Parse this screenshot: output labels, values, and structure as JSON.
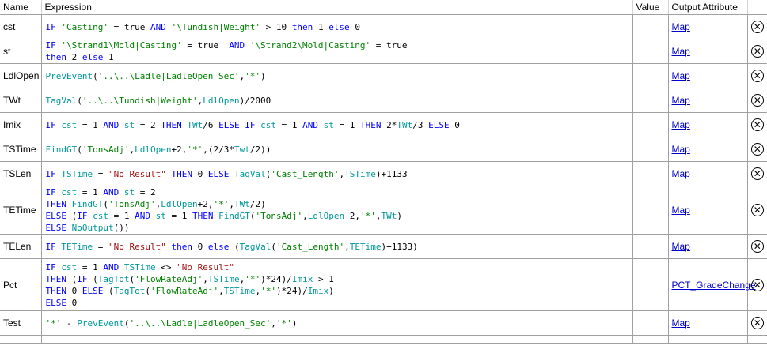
{
  "columns": {
    "name": "Name",
    "expression": "Expression",
    "value": "Value",
    "output": "Output Attribute"
  },
  "rows": [
    {
      "name": "cst",
      "link": "Map",
      "lines": [
        [
          [
            "kw",
            "IF "
          ],
          [
            "st",
            "'Casting'"
          ],
          [
            "tx",
            " = true "
          ],
          [
            "kw",
            "AND "
          ],
          [
            "st",
            "'\\Tundish|Weight'"
          ],
          [
            "tx",
            " > 10 "
          ],
          [
            "kw",
            "then "
          ],
          [
            "tx",
            "1 "
          ],
          [
            "kw",
            "else "
          ],
          [
            "tx",
            "0"
          ]
        ]
      ]
    },
    {
      "name": "st",
      "link": "Map",
      "lines": [
        [
          [
            "kw",
            "IF "
          ],
          [
            "st",
            "'\\Strand1\\Mold|Casting'"
          ],
          [
            "tx",
            " = true  "
          ],
          [
            "kw",
            "AND "
          ],
          [
            "st",
            "'\\Strand2\\Mold|Casting'"
          ],
          [
            "tx",
            " = true"
          ]
        ],
        [
          [
            "kw",
            "then "
          ],
          [
            "tx",
            "2 "
          ],
          [
            "kw",
            "else "
          ],
          [
            "tx",
            "1"
          ]
        ]
      ]
    },
    {
      "name": "LdlOpen",
      "link": "Map",
      "lines": [
        [
          [
            "fn",
            "PrevEvent"
          ],
          [
            "tx",
            "("
          ],
          [
            "st",
            "'..\\..\\Ladle|LadleOpen_Sec'"
          ],
          [
            "tx",
            ","
          ],
          [
            "st",
            "'*'"
          ],
          [
            "tx",
            ")"
          ]
        ]
      ]
    },
    {
      "name": "TWt",
      "link": "Map",
      "lines": [
        [
          [
            "fn",
            "TagVal"
          ],
          [
            "tx",
            "("
          ],
          [
            "st",
            "'..\\..\\Tundish|Weight'"
          ],
          [
            "tx",
            ","
          ],
          [
            "fn",
            "LdlOpen"
          ],
          [
            "tx",
            ")/2000"
          ]
        ]
      ]
    },
    {
      "name": "Imix",
      "link": "Map",
      "lines": [
        [
          [
            "kw",
            "IF "
          ],
          [
            "fn",
            "cst"
          ],
          [
            "tx",
            " = 1 "
          ],
          [
            "kw",
            "AND "
          ],
          [
            "fn",
            "st"
          ],
          [
            "tx",
            " = 2 "
          ],
          [
            "kw",
            "THEN "
          ],
          [
            "fn",
            "TWt"
          ],
          [
            "tx",
            "/6 "
          ],
          [
            "kw",
            "ELSE IF "
          ],
          [
            "fn",
            "cst"
          ],
          [
            "tx",
            " = 1 "
          ],
          [
            "kw",
            "AND "
          ],
          [
            "fn",
            "st"
          ],
          [
            "tx",
            " = 1 "
          ],
          [
            "kw",
            "THEN "
          ],
          [
            "tx",
            "2*"
          ],
          [
            "fn",
            "TWt"
          ],
          [
            "tx",
            "/3 "
          ],
          [
            "kw",
            "ELSE "
          ],
          [
            "tx",
            "0"
          ]
        ]
      ]
    },
    {
      "name": "TSTime",
      "link": "Map",
      "lines": [
        [
          [
            "fn",
            "FindGT"
          ],
          [
            "tx",
            "("
          ],
          [
            "st",
            "'TonsAdj'"
          ],
          [
            "tx",
            ","
          ],
          [
            "fn",
            "LdlOpen"
          ],
          [
            "tx",
            "+2,"
          ],
          [
            "st",
            "'*'"
          ],
          [
            "tx",
            ",(2/3*"
          ],
          [
            "fn",
            "Twt"
          ],
          [
            "tx",
            "/2))"
          ]
        ]
      ]
    },
    {
      "name": "TSLen",
      "link": "Map",
      "lines": [
        [
          [
            "kw",
            "IF "
          ],
          [
            "fn",
            "TSTime"
          ],
          [
            "tx",
            " = "
          ],
          [
            "str",
            "\"No Result\""
          ],
          [
            "kw",
            " THEN "
          ],
          [
            "tx",
            "0 "
          ],
          [
            "kw",
            "ELSE "
          ],
          [
            "fn",
            "TagVal"
          ],
          [
            "tx",
            "("
          ],
          [
            "st",
            "'Cast_Length'"
          ],
          [
            "tx",
            ","
          ],
          [
            "fn",
            "TSTime"
          ],
          [
            "tx",
            ")+1133"
          ]
        ]
      ]
    },
    {
      "name": "TETime",
      "link": "Map",
      "lines": [
        [
          [
            "kw",
            "IF "
          ],
          [
            "fn",
            "cst"
          ],
          [
            "tx",
            " = 1 "
          ],
          [
            "kw",
            "AND "
          ],
          [
            "fn",
            "st"
          ],
          [
            "tx",
            " = 2"
          ]
        ],
        [
          [
            "kw",
            "THEN "
          ],
          [
            "fn",
            "FindGT"
          ],
          [
            "tx",
            "("
          ],
          [
            "st",
            "'TonsAdj'"
          ],
          [
            "tx",
            ","
          ],
          [
            "fn",
            "LdlOpen"
          ],
          [
            "tx",
            "+2,"
          ],
          [
            "st",
            "'*'"
          ],
          [
            "tx",
            ","
          ],
          [
            "fn",
            "TWt"
          ],
          [
            "tx",
            "/2)"
          ]
        ],
        [
          [
            "kw",
            "ELSE "
          ],
          [
            "tx",
            "("
          ],
          [
            "kw",
            "IF "
          ],
          [
            "fn",
            "cst"
          ],
          [
            "tx",
            " = 1 "
          ],
          [
            "kw",
            "AND "
          ],
          [
            "fn",
            "st"
          ],
          [
            "tx",
            " = 1 "
          ],
          [
            "kw",
            "THEN "
          ],
          [
            "fn",
            "FindGT"
          ],
          [
            "tx",
            "("
          ],
          [
            "st",
            "'TonsAdj'"
          ],
          [
            "tx",
            ","
          ],
          [
            "fn",
            "LdlOpen"
          ],
          [
            "tx",
            "+2,"
          ],
          [
            "st",
            "'*'"
          ],
          [
            "tx",
            ","
          ],
          [
            "fn",
            "TWt"
          ],
          [
            "tx",
            ")"
          ]
        ],
        [
          [
            "kw",
            "ELSE "
          ],
          [
            "fn",
            "NoOutput"
          ],
          [
            "tx",
            "())"
          ]
        ]
      ]
    },
    {
      "name": "TELen",
      "link": "Map",
      "lines": [
        [
          [
            "kw",
            "IF "
          ],
          [
            "fn",
            "TETime"
          ],
          [
            "tx",
            " = "
          ],
          [
            "str",
            "\"No Result\""
          ],
          [
            "kw",
            " then "
          ],
          [
            "tx",
            "0 "
          ],
          [
            "kw",
            "else "
          ],
          [
            "tx",
            "("
          ],
          [
            "fn",
            "TagVal"
          ],
          [
            "tx",
            "("
          ],
          [
            "st",
            "'Cast_Length'"
          ],
          [
            "tx",
            ","
          ],
          [
            "fn",
            "TETime"
          ],
          [
            "tx",
            ")+1133)"
          ]
        ]
      ]
    },
    {
      "name": "Pct",
      "link": "PCT_GradeChange",
      "lines": [
        [
          [
            "kw",
            "IF "
          ],
          [
            "fn",
            "cst"
          ],
          [
            "tx",
            " = 1 "
          ],
          [
            "kw",
            "AND "
          ],
          [
            "fn",
            "TSTime"
          ],
          [
            "tx",
            " <> "
          ],
          [
            "str",
            "\"No Result\""
          ]
        ],
        [
          [
            "kw",
            "THEN "
          ],
          [
            "tx",
            "("
          ],
          [
            "kw",
            "IF "
          ],
          [
            "tx",
            "("
          ],
          [
            "fn",
            "TagTot"
          ],
          [
            "tx",
            "("
          ],
          [
            "st",
            "'FlowRateAdj'"
          ],
          [
            "tx",
            ","
          ],
          [
            "fn",
            "TSTime"
          ],
          [
            "tx",
            ","
          ],
          [
            "st",
            "'*'"
          ],
          [
            "tx",
            ")*24)/"
          ],
          [
            "fn",
            "Imix"
          ],
          [
            "tx",
            " > 1"
          ]
        ],
        [
          [
            "kw",
            "THEN "
          ],
          [
            "tx",
            "0 "
          ],
          [
            "kw",
            "ELSE "
          ],
          [
            "tx",
            "("
          ],
          [
            "fn",
            "TagTot"
          ],
          [
            "tx",
            "("
          ],
          [
            "st",
            "'FlowRateAdj'"
          ],
          [
            "tx",
            ","
          ],
          [
            "fn",
            "TSTime"
          ],
          [
            "tx",
            ","
          ],
          [
            "st",
            "'*'"
          ],
          [
            "tx",
            ")*24)/"
          ],
          [
            "fn",
            "Imix"
          ],
          [
            "tx",
            ")"
          ]
        ],
        [
          [
            "kw",
            "ELSE "
          ],
          [
            "tx",
            "0"
          ]
        ]
      ]
    },
    {
      "name": "Test",
      "link": "Map",
      "lines": [
        [
          [
            "st",
            "'*'"
          ],
          [
            "tx",
            " - "
          ],
          [
            "fn",
            "PrevEvent"
          ],
          [
            "tx",
            "("
          ],
          [
            "st",
            "'..\\..\\Ladle|LadleOpen_Sec'"
          ],
          [
            "tx",
            ","
          ],
          [
            "st",
            "'*'"
          ],
          [
            "tx",
            ")"
          ]
        ]
      ]
    }
  ],
  "delete_icon": "close-circle-icon",
  "colors": {
    "keyword": "#0000ff",
    "function": "#009999",
    "string": "#008000",
    "literal": "#a31515",
    "link": "#0000cc"
  }
}
